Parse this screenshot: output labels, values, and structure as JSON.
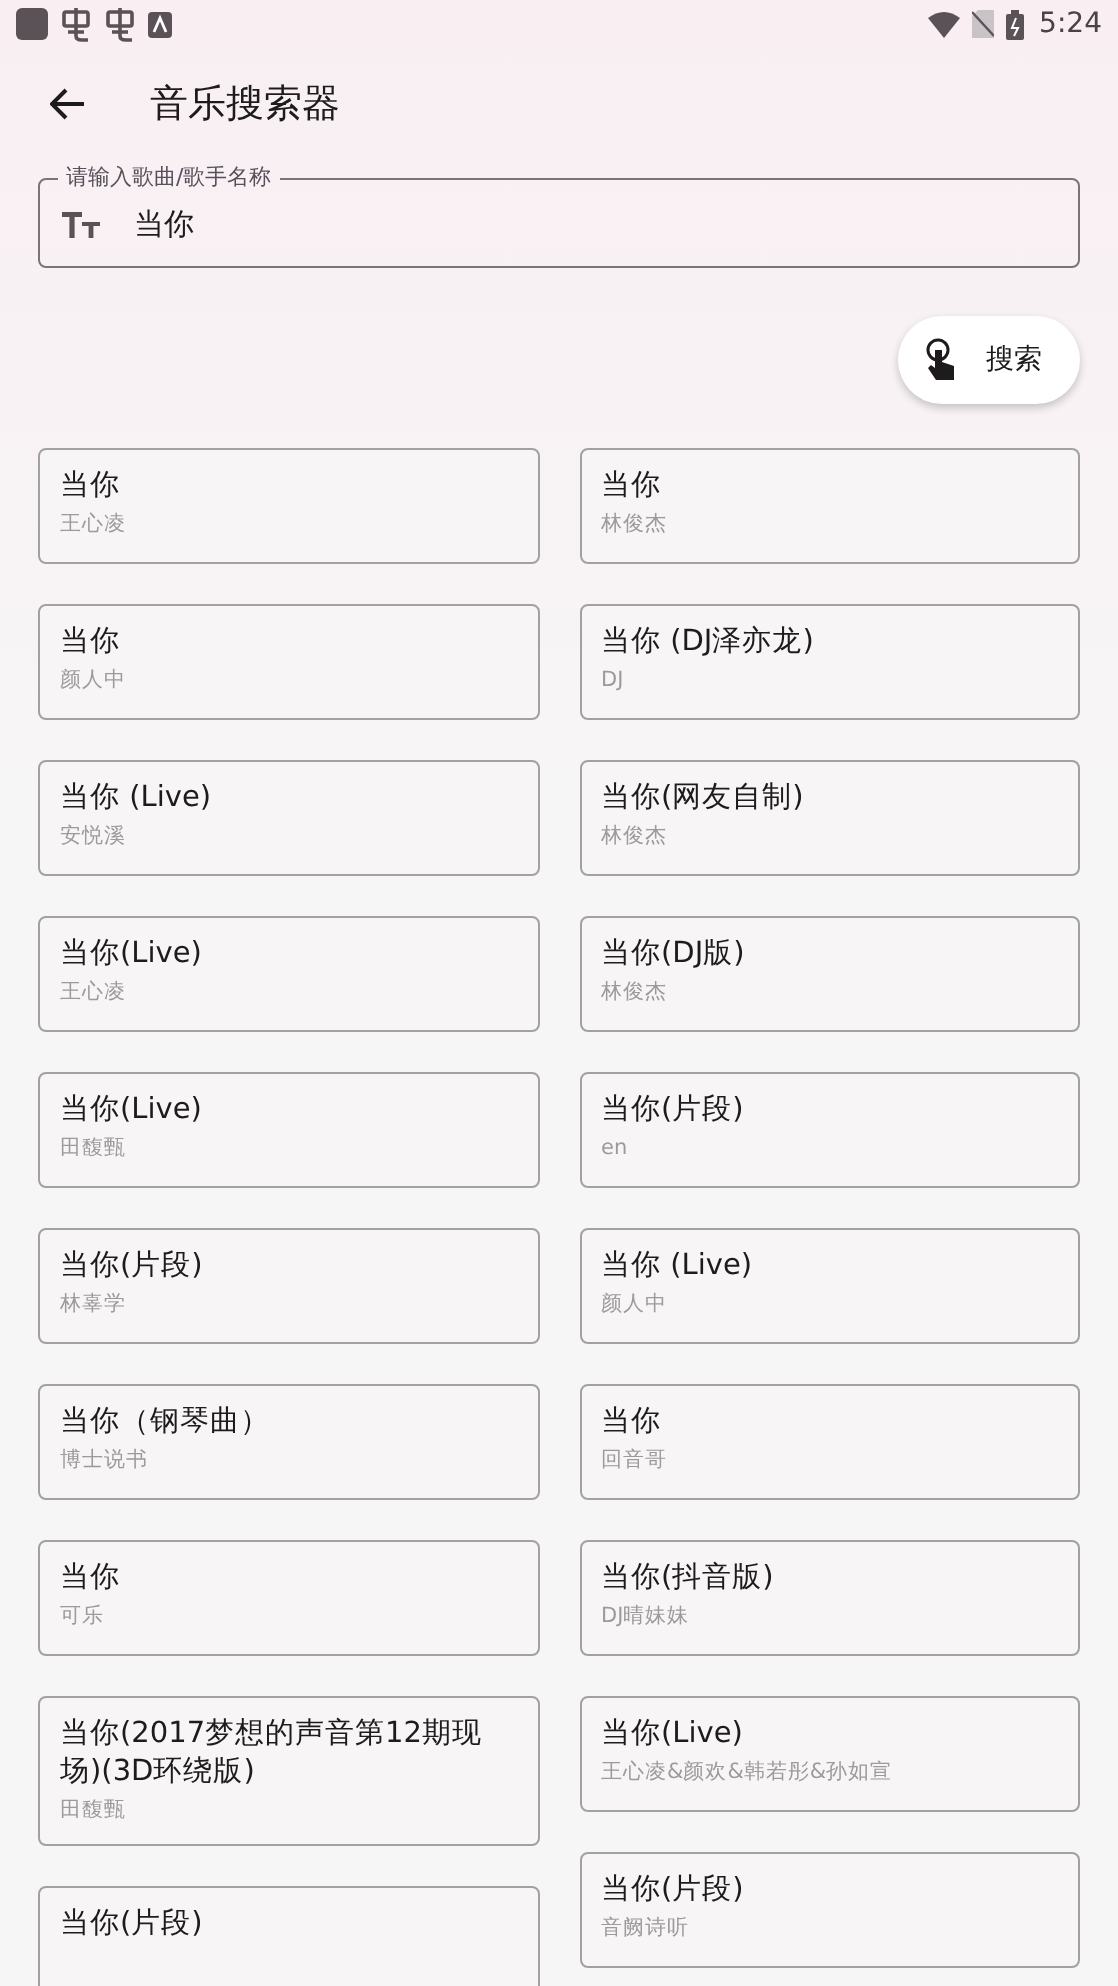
{
  "status_bar": {
    "time": "5:24"
  },
  "header": {
    "title": "音乐搜索器"
  },
  "search": {
    "label": "请输入歌曲/歌手名称",
    "value": "当你"
  },
  "search_button": {
    "label": "搜索"
  },
  "results": {
    "left": [
      {
        "title": "当你",
        "artist": "王心凌"
      },
      {
        "title": "当你",
        "artist": "颜人中"
      },
      {
        "title": "当你 (Live)",
        "artist": "安悦溪"
      },
      {
        "title": "当你(Live)",
        "artist": "王心凌"
      },
      {
        "title": "当你(Live)",
        "artist": "田馥甄"
      },
      {
        "title": "当你(片段)",
        "artist": "林辜学"
      },
      {
        "title": "当你（钢琴曲）",
        "artist": "博士说书"
      },
      {
        "title": "当你",
        "artist": "可乐"
      },
      {
        "title": "当你(2017梦想的声音第12期现场)(3D环绕版)",
        "artist": "田馥甄"
      },
      {
        "title": "当你(片段)"
      }
    ],
    "right": [
      {
        "title": "当你",
        "artist": "林俊杰"
      },
      {
        "title": "当你 (DJ泽亦龙)",
        "artist": "DJ"
      },
      {
        "title": "当你(网友自制)",
        "artist": "林俊杰"
      },
      {
        "title": "当你(DJ版)",
        "artist": "林俊杰"
      },
      {
        "title": "当你(片段)",
        "artist": "en"
      },
      {
        "title": "当你 (Live)",
        "artist": "颜人中"
      },
      {
        "title": "当你",
        "artist": "回音哥"
      },
      {
        "title": "当你(抖音版)",
        "artist": "DJ晴妹妹"
      },
      {
        "title": "当你(Live)",
        "artist": "王心凌&颜欢&韩若彤&孙如宣"
      },
      {
        "title": "当你(片段)",
        "artist": "音阙诗听"
      }
    ]
  }
}
